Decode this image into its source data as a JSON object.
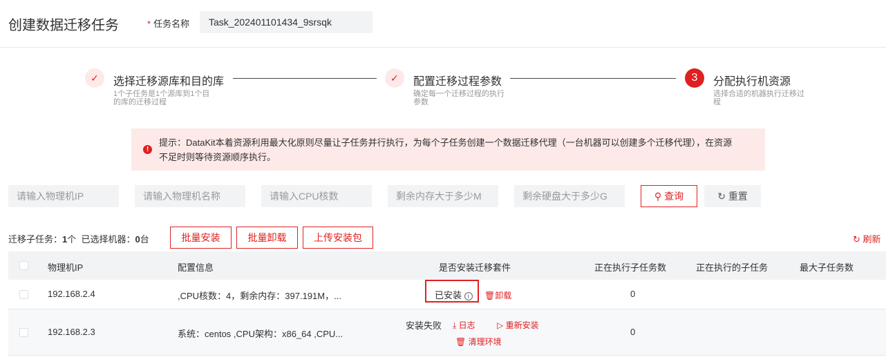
{
  "header": {
    "title": "创建数据迁移任务",
    "task_name_label": "任务名称",
    "task_name_required": "*",
    "task_name_value": "Task_202401101434_9srsqk"
  },
  "steps": [
    {
      "icon": "check-icon",
      "label": "选择迁移源库和目的库",
      "desc": "1个子任务是1个源库到1个目的库的迁移过程",
      "status": "done"
    },
    {
      "icon": "check-icon",
      "label": "配置迁移过程参数",
      "desc": "确定每一个迁移过程的执行参数",
      "status": "done"
    },
    {
      "number": "3",
      "label": "分配执行机资源",
      "desc": "选择合适的机器执行迁移过程",
      "status": "active"
    }
  ],
  "alert": {
    "text": "提示：DataKit本着资源利用最大化原则尽量让子任务并行执行，为每个子任务创建一个数据迁移代理（一台机器可以创建多个迁移代理），在资源不足时则等待资源顺序执行。"
  },
  "filters": {
    "ip_placeholder": "请输入物理机IP",
    "name_placeholder": "请输入物理机名称",
    "cpu_placeholder": "请输入CPU核数",
    "mem_placeholder": "剩余内存大于多少M",
    "disk_placeholder": "剩余硬盘大于多少G",
    "query_label": "查询",
    "reset_label": "重置"
  },
  "toolbar": {
    "subtask_label": "迁移子任务：",
    "subtask_count": "1",
    "subtask_unit": "个",
    "selected_label": "已选择机器：",
    "selected_count": "0",
    "selected_unit": "台",
    "batch_install": "批量安装",
    "batch_uninstall": "批量卸载",
    "upload_package": "上传安装包",
    "refresh": "刷新"
  },
  "table": {
    "columns": [
      "物理机IP",
      "配置信息",
      "是否安装迁移套件",
      "正在执行子任务数",
      "正在执行的子任务",
      "最大子任务数"
    ],
    "rows": [
      {
        "ip": "192.168.2.4",
        "config": ",CPU核数：4，剩余内存：397.191M，...",
        "install_status": "已安装",
        "actions": [
          "卸载"
        ],
        "running_count": "0",
        "running_tasks": "",
        "max_tasks": ""
      },
      {
        "ip": "192.168.2.3",
        "config": "系统：centos ,CPU架构：x86_64 ,CPU...",
        "install_status": "安装失败",
        "actions": [
          "日志",
          "重新安装",
          "清理环境"
        ],
        "running_count": "0",
        "running_tasks": "",
        "max_tasks": ""
      }
    ]
  },
  "colors": {
    "accent": "#e02020",
    "alert_bg": "#fde9e8",
    "input_bg": "#f2f3f5"
  }
}
